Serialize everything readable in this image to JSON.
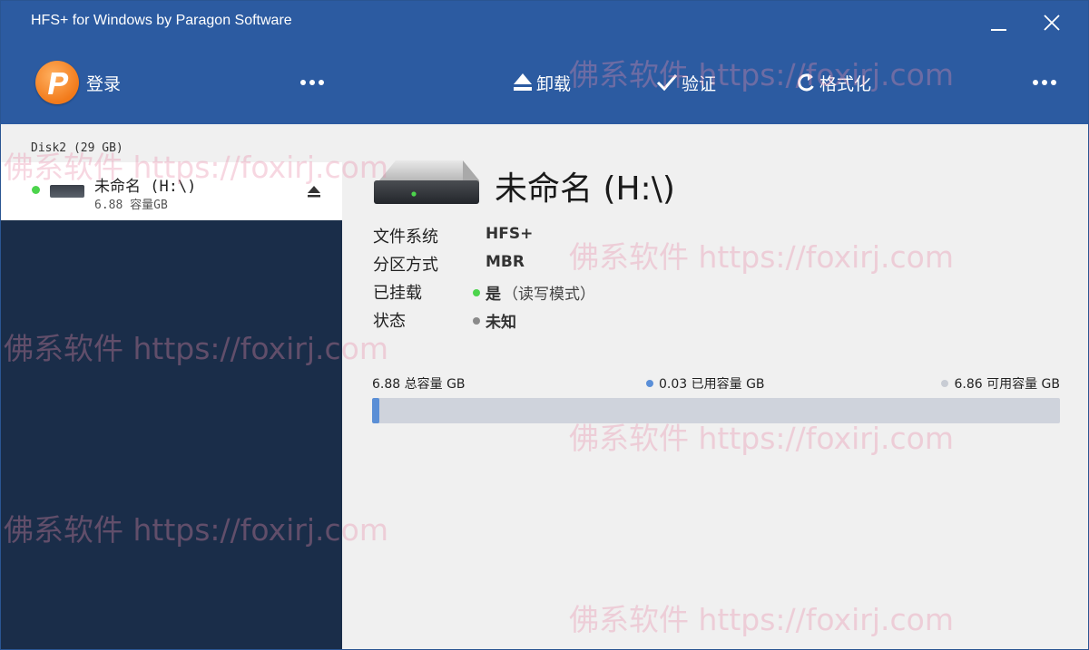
{
  "window": {
    "title": "HFS+ for Windows by Paragon Software"
  },
  "toolbar": {
    "login_label": "登录",
    "unmount_label": "卸载",
    "verify_label": "验证",
    "format_label": "格式化"
  },
  "sidebar": {
    "disk_label": "Disk2 (29 GB)",
    "volume": {
      "name": "未命名 (H:\\)",
      "size": "6.88 容量GB",
      "status_color": "#4cd44c"
    }
  },
  "main": {
    "volume_title": "未命名 (H:\\)",
    "properties": [
      {
        "key": "文件系统",
        "value": "HFS+"
      },
      {
        "key": "分区方式",
        "value": "MBR"
      },
      {
        "key": "已挂载",
        "value": "是",
        "extra": "（读写模式）",
        "dot_color": "#4cd44c"
      },
      {
        "key": "状态",
        "value": "未知",
        "dot_color": "#8a8a8a"
      }
    ],
    "usage": {
      "total": "6.88 总容量 GB",
      "used": "0.03 已用容量 GB",
      "free": "6.86 可用容量 GB",
      "used_fraction": 0.0044
    }
  },
  "watermark": "佛系软件 https://foxirj.com",
  "colors": {
    "header_bg": "#2c5ba1",
    "sidebar_bg": "#1a2d49",
    "accent": "#5b8fd6"
  }
}
